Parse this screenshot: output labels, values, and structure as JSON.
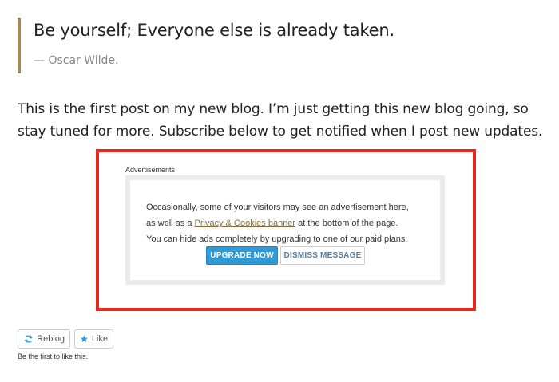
{
  "quote": {
    "text": "Be yourself; Everyone else is already taken.",
    "cite": "— Oscar Wilde."
  },
  "post": {
    "paragraph": "This is the first post on my new blog. I’m just getting this new blog going, so stay tuned for more. Subscribe below to get notified when I post new updates."
  },
  "ads": {
    "label": "Advertisements",
    "line1": "Occasionally, some of your visitors may see an advertisement here,",
    "line2_prefix": "as well as a ",
    "line2_link": "Privacy & Cookies banner",
    "line2_suffix": " at the bottom of the page.",
    "line3": "You can hide ads completely by upgrading to one of our paid plans.",
    "upgrade_label": "UPGRADE NOW",
    "dismiss_label": "DISMISS MESSAGE"
  },
  "sharing": {
    "reblog_label": "Reblog",
    "like_label": "Like",
    "like_note": "Be the first to like this."
  },
  "colors": {
    "highlight_border": "#e8271d",
    "quote_border": "#a08a5c",
    "upgrade_button": "#2e9ad6",
    "link": "#8a6d3b"
  },
  "icons": [
    "reblog-icon",
    "star-icon"
  ]
}
